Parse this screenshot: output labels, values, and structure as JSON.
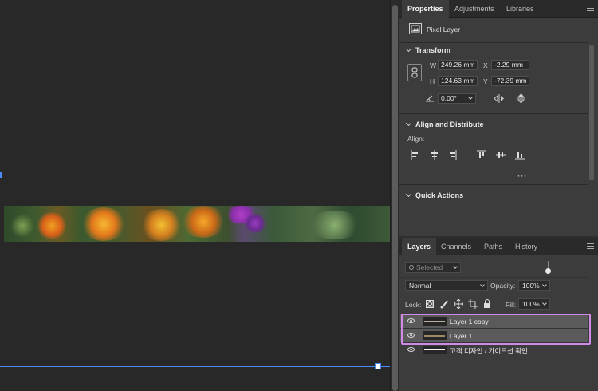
{
  "properties_panel": {
    "tabs": [
      "Properties",
      "Adjustments",
      "Libraries"
    ],
    "active_tab": "Properties",
    "layer_type": "Pixel Layer",
    "transform": {
      "header": "Transform",
      "w_label": "W",
      "w_value": "249.26 mm",
      "x_label": "X",
      "x_value": "-2.29 mm",
      "h_label": "H",
      "h_value": "124.63 mm",
      "y_label": "Y",
      "y_value": "-72.39 mm",
      "angle_value": "0.00°"
    },
    "align": {
      "header": "Align and Distribute",
      "label": "Align:",
      "more": "•••"
    },
    "quick_actions": {
      "header": "Quick Actions"
    }
  },
  "layers_panel": {
    "tabs": [
      "Layers",
      "Channels",
      "Paths",
      "History"
    ],
    "active_tab": "Layers",
    "filter_placeholder": "Selected",
    "blend_mode": "Normal",
    "opacity_label": "Opacity:",
    "opacity_value": "100%",
    "lock_label": "Lock:",
    "fill_label": "Fill:",
    "fill_value": "100%",
    "layers": [
      {
        "name": "Layer 1 copy",
        "selected": true
      },
      {
        "name": "Layer 1",
        "selected": true
      },
      {
        "name": "고객 디자인 / 가이드선 확인",
        "selected": false
      }
    ]
  },
  "colors": {
    "canvas_bg": "#282828",
    "panel_bg": "#3c3c3c",
    "selection_outline": "#d08ae8",
    "guide_cyan": "#4bd6e0",
    "guide_blue": "#4a8bff"
  }
}
